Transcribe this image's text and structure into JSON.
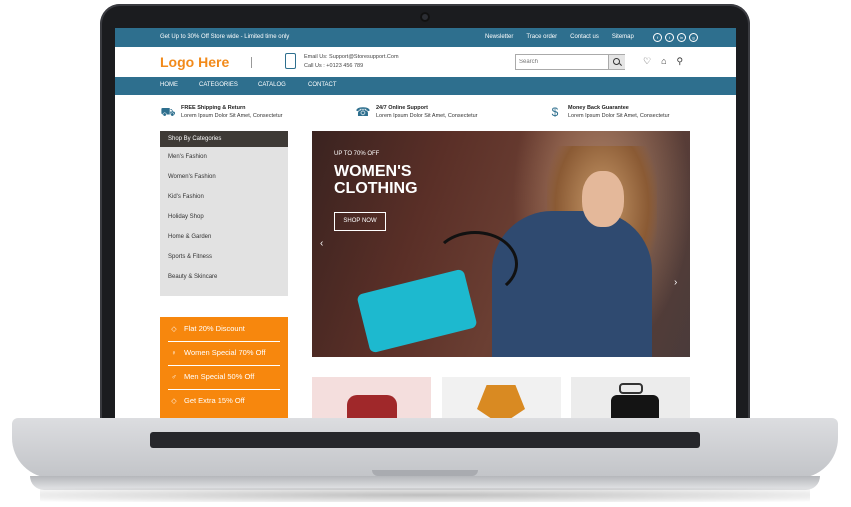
{
  "topbar": {
    "promo": "Get Up to 30% Off Store wide - Limited time only",
    "links": [
      "Newsletter",
      "Trace order",
      "Contact us",
      "Sitemap"
    ],
    "social": [
      "f",
      "t",
      "in",
      "g"
    ]
  },
  "header": {
    "logo": "Logo Here",
    "email": "Email Us: Support@Storesupport.Com",
    "call": "Call Us : +0123 456 789",
    "search_placeholder": "Search"
  },
  "nav": [
    "HOME",
    "CATEGORIES",
    "CATALOG",
    "CONTACT"
  ],
  "features": [
    {
      "title": "FREE Shipping & Return",
      "text": "Lorem Ipsum Dolor Sit Amet, Consectetur"
    },
    {
      "title": "24/7 Online Support",
      "text": "Lorem Ipsum Dolor Sit Amet, Consectetur"
    },
    {
      "title": "Money Back Guarantee",
      "text": "Lorem Ipsum Dolor Sit Amet, Consectetur"
    }
  ],
  "sidebar": {
    "heading": "Shop By Categories",
    "categories": [
      "Men's Fashion",
      "Women's Fashion",
      "Kid's Fashion",
      "Holiday Shop",
      "Home & Garden",
      "Sports & Fitness",
      "Beauty & Skincare"
    ]
  },
  "offers": [
    "Flat 20% Discount",
    "Women Special 70% Off",
    "Men Special 50% Off",
    "Get Extra 15% Off"
  ],
  "hero": {
    "upto": "UP TO 70% OFF",
    "title": "WOMEN'S CLOTHING",
    "button": "SHOP NOW"
  },
  "colors": {
    "primary": "#2e6f8e",
    "accent": "#f7870d",
    "logo": "#f28a1a"
  }
}
